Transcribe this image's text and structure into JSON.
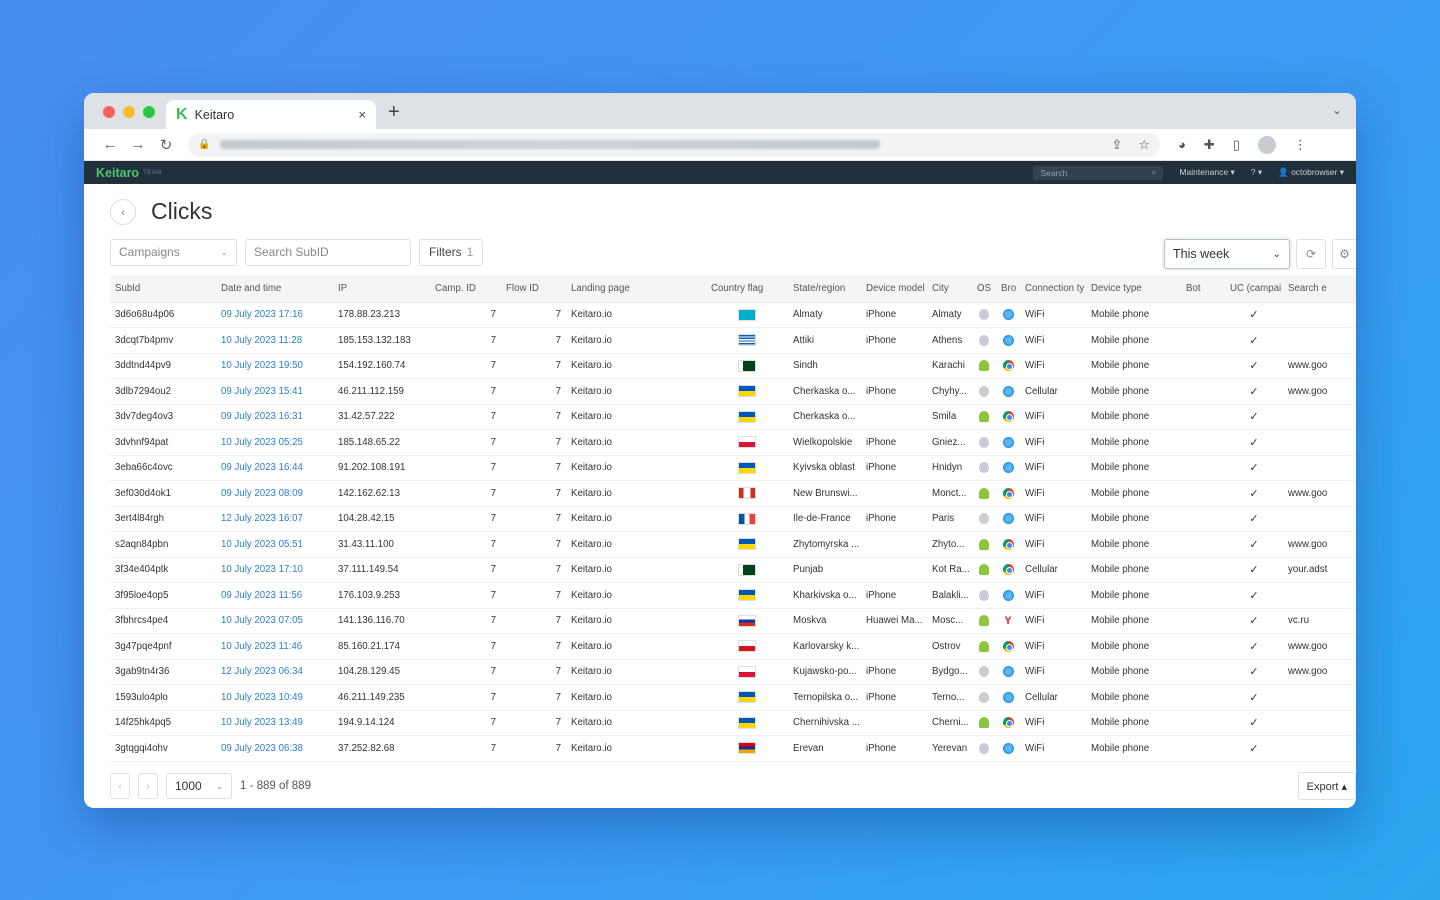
{
  "browser": {
    "tab_title": "Keitaro",
    "tab_logo": "K",
    "new_tab": "+",
    "close_tab": "×"
  },
  "app": {
    "brand": "Keitaro",
    "team_tag": "TEAM",
    "search_placeholder": "Search",
    "maintenance": "Maintenance ▾",
    "help": "? ▾",
    "user": "octobrowser ▾"
  },
  "page": {
    "title": "Clicks",
    "campaigns_label": "Campaigns",
    "subid_placeholder": "Search SubID",
    "filters_label": "Filters",
    "filters_count": "1",
    "period": "This week"
  },
  "table": {
    "headers": [
      "SubId",
      "Date and time",
      "IP",
      "Camp. ID",
      "Flow ID",
      "Landing page",
      "Country flag",
      "State/region",
      "Device model",
      "City",
      "OS",
      "Bro",
      "Connection ty",
      "Device type",
      "Bot",
      "UC (campai",
      "Search e"
    ],
    "rows": [
      {
        "subid": "3d6o68u4p06",
        "date": "09 July 2023 17:16",
        "ip": "178.88.23.213",
        "camp": "7",
        "flow": "7",
        "lp": "Keitaro.io",
        "flag": "kz",
        "state": "Almaty",
        "model": "iPhone",
        "city": "Almaty",
        "os": "apple",
        "br": "safari",
        "conn": "WiFi",
        "dtype": "Mobile phone",
        "bot": "",
        "uc": "✓",
        "search": ""
      },
      {
        "subid": "3dcqt7b4pmv",
        "date": "10 July 2023 11:28",
        "ip": "185.153.132.183",
        "camp": "7",
        "flow": "7",
        "lp": "Keitaro.io",
        "flag": "gr",
        "state": "Attiki",
        "model": "iPhone",
        "city": "Athens",
        "os": "apple",
        "br": "safari",
        "conn": "WiFi",
        "dtype": "Mobile phone",
        "bot": "",
        "uc": "✓",
        "search": ""
      },
      {
        "subid": "3ddtnd44pv9",
        "date": "10 July 2023 19:50",
        "ip": "154.192.160.74",
        "camp": "7",
        "flow": "7",
        "lp": "Keitaro.io",
        "flag": "pk",
        "state": "Sindh",
        "model": "",
        "city": "Karachi",
        "os": "android",
        "br": "chrome",
        "conn": "WiFi",
        "dtype": "Mobile phone",
        "bot": "",
        "uc": "✓",
        "search": "www.goo"
      },
      {
        "subid": "3dlb7294ou2",
        "date": "09 July 2023 15:41",
        "ip": "46.211.112.159",
        "camp": "7",
        "flow": "7",
        "lp": "Keitaro.io",
        "flag": "ua",
        "state": "Cherkaska o...",
        "model": "iPhone",
        "city": "Chyhy...",
        "os": "apple",
        "br": "safari",
        "conn": "Cellular",
        "dtype": "Mobile phone",
        "bot": "",
        "uc": "✓",
        "search": "www.goo"
      },
      {
        "subid": "3dv7deg4ov3",
        "date": "09 July 2023 16:31",
        "ip": "31.42.57.222",
        "camp": "7",
        "flow": "7",
        "lp": "Keitaro.io",
        "flag": "ua",
        "state": "Cherkaska o...",
        "model": "",
        "city": "Smila",
        "os": "android",
        "br": "chrome",
        "conn": "WiFi",
        "dtype": "Mobile phone",
        "bot": "",
        "uc": "✓",
        "search": ""
      },
      {
        "subid": "3dvhnf94pat",
        "date": "10 July 2023 05:25",
        "ip": "185.148.65.22",
        "camp": "7",
        "flow": "7",
        "lp": "Keitaro.io",
        "flag": "pl",
        "state": "Wielkopolskie",
        "model": "iPhone",
        "city": "Gniez...",
        "os": "apple",
        "br": "safari",
        "conn": "WiFi",
        "dtype": "Mobile phone",
        "bot": "",
        "uc": "✓",
        "search": ""
      },
      {
        "subid": "3eba66c4ovc",
        "date": "09 July 2023 16:44",
        "ip": "91.202.108.191",
        "camp": "7",
        "flow": "7",
        "lp": "Keitaro.io",
        "flag": "ua",
        "state": "Kyivska oblast",
        "model": "iPhone",
        "city": "Hnidyn",
        "os": "apple",
        "br": "safari",
        "conn": "WiFi",
        "dtype": "Mobile phone",
        "bot": "",
        "uc": "✓",
        "search": ""
      },
      {
        "subid": "3ef030d4ok1",
        "date": "09 July 2023 08:09",
        "ip": "142.162.62.13",
        "camp": "7",
        "flow": "7",
        "lp": "Keitaro.io",
        "flag": "ca",
        "state": "New Brunswi...",
        "model": "",
        "city": "Monct...",
        "os": "android",
        "br": "chrome",
        "conn": "WiFi",
        "dtype": "Mobile phone",
        "bot": "",
        "uc": "✓",
        "search": "www.goo"
      },
      {
        "subid": "3ert4l84rgh",
        "date": "12 July 2023 16:07",
        "ip": "104.28.42.15",
        "camp": "7",
        "flow": "7",
        "lp": "Keitaro.io",
        "flag": "fr",
        "state": "Ile-de-France",
        "model": "iPhone",
        "city": "Paris",
        "os": "apple",
        "br": "safari",
        "conn": "WiFi",
        "dtype": "Mobile phone",
        "bot": "",
        "uc": "✓",
        "search": ""
      },
      {
        "subid": "s2aqn84pbn",
        "date": "10 July 2023 05:51",
        "ip": "31.43.11.100",
        "camp": "7",
        "flow": "7",
        "lp": "Keitaro.io",
        "flag": "ua",
        "state": "Zhytomyrska ...",
        "model": "",
        "city": "Zhyto...",
        "os": "android",
        "br": "chrome",
        "conn": "WiFi",
        "dtype": "Mobile phone",
        "bot": "",
        "uc": "✓",
        "search": "www.goo"
      },
      {
        "subid": "3f34e404ptk",
        "date": "10 July 2023 17:10",
        "ip": "37.111.149.54",
        "camp": "7",
        "flow": "7",
        "lp": "Keitaro.io",
        "flag": "pk",
        "state": "Punjab",
        "model": "",
        "city": "Kot Ra...",
        "os": "android",
        "br": "chrome",
        "conn": "Cellular",
        "dtype": "Mobile phone",
        "bot": "",
        "uc": "✓",
        "search": "your.adst"
      },
      {
        "subid": "3f95loe4op5",
        "date": "09 July 2023 11:56",
        "ip": "176.103.9.253",
        "camp": "7",
        "flow": "7",
        "lp": "Keitaro.io",
        "flag": "ua",
        "state": "Kharkivska o...",
        "model": "iPhone",
        "city": "Balakli...",
        "os": "apple",
        "br": "safari",
        "conn": "WiFi",
        "dtype": "Mobile phone",
        "bot": "",
        "uc": "✓",
        "search": ""
      },
      {
        "subid": "3fbhrcs4pe4",
        "date": "10 July 2023 07:05",
        "ip": "141.136.116.70",
        "camp": "7",
        "flow": "7",
        "lp": "Keitaro.io",
        "flag": "ru",
        "state": "Moskva",
        "model": "Huawei Ma...",
        "city": "Mosc...",
        "os": "android",
        "br": "yandex",
        "conn": "WiFi",
        "dtype": "Mobile phone",
        "bot": "",
        "uc": "✓",
        "search": "vc.ru"
      },
      {
        "subid": "3g47pqe4pnf",
        "date": "10 July 2023 11:46",
        "ip": "85.160.21.174",
        "camp": "7",
        "flow": "7",
        "lp": "Keitaro.io",
        "flag": "cz",
        "state": "Karlovarsky k...",
        "model": "",
        "city": "Ostrov",
        "os": "android",
        "br": "chrome",
        "conn": "WiFi",
        "dtype": "Mobile phone",
        "bot": "",
        "uc": "✓",
        "search": "www.goo"
      },
      {
        "subid": "3gab9tn4r36",
        "date": "12 July 2023 06:34",
        "ip": "104.28.129.45",
        "camp": "7",
        "flow": "7",
        "lp": "Keitaro.io",
        "flag": "pl",
        "state": "Kujawsko-po...",
        "model": "iPhone",
        "city": "Bydgo...",
        "os": "apple",
        "br": "safari",
        "conn": "WiFi",
        "dtype": "Mobile phone",
        "bot": "",
        "uc": "✓",
        "search": "www.goo"
      },
      {
        "subid": "1593ulo4plo",
        "date": "10 July 2023 10:49",
        "ip": "46.211.149.235",
        "camp": "7",
        "flow": "7",
        "lp": "Keitaro.io",
        "flag": "ua",
        "state": "Ternopilska o...",
        "model": "iPhone",
        "city": "Terno...",
        "os": "apple",
        "br": "safari",
        "conn": "Cellular",
        "dtype": "Mobile phone",
        "bot": "",
        "uc": "✓",
        "search": ""
      },
      {
        "subid": "14f25hk4pq5",
        "date": "10 July 2023 13:49",
        "ip": "194.9.14.124",
        "camp": "7",
        "flow": "7",
        "lp": "Keitaro.io",
        "flag": "ua",
        "state": "Chernihivska ...",
        "model": "",
        "city": "Cherni...",
        "os": "android",
        "br": "chrome",
        "conn": "WiFi",
        "dtype": "Mobile phone",
        "bot": "",
        "uc": "✓",
        "search": ""
      },
      {
        "subid": "3gtqgqi4ohv",
        "date": "09 July 2023 06:38",
        "ip": "37.252.82.68",
        "camp": "7",
        "flow": "7",
        "lp": "Keitaro.io",
        "flag": "am",
        "state": "Erevan",
        "model": "iPhone",
        "city": "Yerevan",
        "os": "apple",
        "br": "safari",
        "conn": "WiFi",
        "dtype": "Mobile phone",
        "bot": "",
        "uc": "✓",
        "search": ""
      }
    ]
  },
  "footer": {
    "page_size": "1000",
    "range": "1 - 889 of 889",
    "export": "Export ▴"
  },
  "colors": {
    "accent_green": "#4ac772",
    "header_dark": "#22303b",
    "link_blue": "#2d7fc8"
  }
}
